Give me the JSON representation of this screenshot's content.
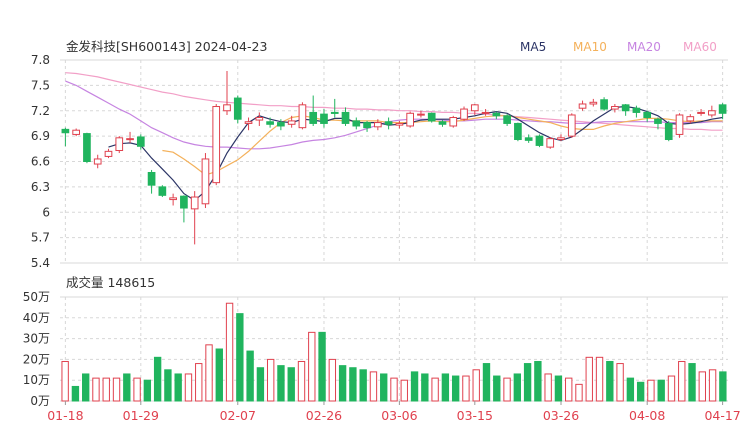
{
  "header": {
    "title": "金发科技[SH600143] 2024-04-23",
    "ma_labels": [
      {
        "label": "MA5",
        "color": "#2c3566"
      },
      {
        "label": "MA10",
        "color": "#f4b15b"
      },
      {
        "label": "MA20",
        "color": "#c684e1"
      },
      {
        "label": "MA60",
        "color": "#f29fc7"
      }
    ]
  },
  "volume_panel": {
    "label": "成交量 148615"
  },
  "colors": {
    "up": "#e0414e",
    "down": "#20b45e",
    "grid": "#d8d8d8"
  },
  "chart_data": [
    {
      "type": "candlestick",
      "title": "金发科技[SH600143] 2024-04-23",
      "ylim": [
        5.4,
        7.8
      ],
      "yticks": [
        "7.8",
        "7.5",
        "7.2",
        "6.9",
        "6.6",
        "6.3",
        "6",
        "5.7",
        "5.4"
      ],
      "ytick_values": [
        7.8,
        7.5,
        7.2,
        6.9,
        6.6,
        6.3,
        6.0,
        5.7,
        5.4
      ],
      "xtick_labels": [
        "01-18",
        "01-29",
        "02-07",
        "02-26",
        "03-06",
        "03-15",
        "03-26",
        "04-08",
        "04-17"
      ],
      "xtick_index": [
        0,
        7,
        16,
        24,
        31,
        38,
        46,
        54,
        61
      ],
      "grid": true,
      "candles": [
        [
          6.98,
          6.94,
          7.0,
          6.78
        ],
        [
          6.92,
          6.97,
          6.99,
          6.9
        ],
        [
          6.93,
          6.6,
          6.94,
          6.58
        ],
        [
          6.57,
          6.63,
          6.68,
          6.52
        ],
        [
          6.66,
          6.72,
          6.75,
          6.64
        ],
        [
          6.73,
          6.88,
          6.9,
          6.7
        ],
        [
          6.86,
          6.87,
          6.95,
          6.82
        ],
        [
          6.89,
          6.78,
          6.92,
          6.74
        ],
        [
          6.47,
          6.32,
          6.5,
          6.22
        ],
        [
          6.3,
          6.2,
          6.32,
          6.18
        ],
        [
          6.15,
          6.17,
          6.22,
          6.08
        ],
        [
          6.19,
          6.05,
          6.2,
          5.88
        ],
        [
          6.04,
          6.18,
          6.25,
          5.62
        ],
        [
          6.1,
          6.63,
          6.7,
          6.05
        ],
        [
          6.35,
          7.25,
          7.28,
          6.32
        ],
        [
          7.2,
          7.27,
          7.67,
          7.15
        ],
        [
          7.35,
          7.1,
          7.38,
          7.05
        ],
        [
          7.05,
          7.07,
          7.12,
          6.97
        ],
        [
          7.09,
          7.12,
          7.18,
          7.02
        ],
        [
          7.07,
          7.04,
          7.12,
          7.0
        ],
        [
          7.06,
          7.02,
          7.1,
          6.97
        ],
        [
          7.04,
          7.08,
          7.14,
          7.0
        ],
        [
          7.0,
          7.27,
          7.3,
          6.98
        ],
        [
          7.18,
          7.05,
          7.38,
          7.02
        ],
        [
          7.16,
          7.05,
          7.22,
          7.0
        ],
        [
          7.18,
          7.17,
          7.34,
          7.12
        ],
        [
          7.18,
          7.05,
          7.24,
          7.02
        ],
        [
          7.08,
          7.02,
          7.12,
          6.98
        ],
        [
          7.06,
          7.0,
          7.08,
          6.95
        ],
        [
          7.01,
          7.06,
          7.1,
          6.97
        ],
        [
          7.07,
          7.04,
          7.12,
          6.98
        ],
        [
          7.03,
          7.05,
          7.08,
          6.99
        ],
        [
          7.02,
          7.17,
          7.19,
          7.0
        ],
        [
          7.15,
          7.16,
          7.2,
          7.12
        ],
        [
          7.17,
          7.08,
          7.18,
          7.06
        ],
        [
          7.07,
          7.04,
          7.09,
          7.01
        ],
        [
          7.02,
          7.12,
          7.14,
          7.0
        ],
        [
          7.1,
          7.22,
          7.25,
          7.08
        ],
        [
          7.2,
          7.27,
          7.28,
          7.15
        ],
        [
          7.18,
          7.18,
          7.22,
          7.14
        ],
        [
          7.17,
          7.14,
          7.19,
          7.1
        ],
        [
          7.14,
          7.05,
          7.16,
          7.02
        ],
        [
          7.05,
          6.86,
          7.06,
          6.84
        ],
        [
          6.88,
          6.85,
          6.92,
          6.82
        ],
        [
          6.9,
          6.79,
          6.92,
          6.77
        ],
        [
          6.77,
          6.87,
          6.89,
          6.75
        ],
        [
          6.86,
          6.88,
          6.92,
          6.84
        ],
        [
          6.9,
          7.15,
          7.17,
          6.88
        ],
        [
          7.23,
          7.28,
          7.32,
          7.2
        ],
        [
          7.28,
          7.3,
          7.34,
          7.25
        ],
        [
          7.33,
          7.22,
          7.36,
          7.2
        ],
        [
          7.22,
          7.25,
          7.28,
          7.18
        ],
        [
          7.27,
          7.2,
          7.28,
          7.14
        ],
        [
          7.23,
          7.18,
          7.26,
          7.12
        ],
        [
          7.18,
          7.12,
          7.2,
          7.07
        ],
        [
          7.1,
          7.05,
          7.12,
          6.98
        ],
        [
          7.05,
          6.86,
          7.08,
          6.84
        ],
        [
          6.92,
          7.15,
          7.17,
          6.88
        ],
        [
          7.08,
          7.13,
          7.16,
          7.05
        ],
        [
          7.17,
          7.18,
          7.22,
          7.14
        ],
        [
          7.15,
          7.2,
          7.26,
          7.12
        ],
        [
          7.27,
          7.17,
          7.29,
          7.1
        ]
      ],
      "ma": {
        "MA5": [
          null,
          null,
          null,
          null,
          6.77,
          6.81,
          6.82,
          6.79,
          6.64,
          6.51,
          6.38,
          6.22,
          6.14,
          6.25,
          6.45,
          6.7,
          6.89,
          7.06,
          7.14,
          7.1,
          7.07,
          7.06,
          7.1,
          7.09,
          7.07,
          7.11,
          7.11,
          7.06,
          7.06,
          7.06,
          7.03,
          7.04,
          7.06,
          7.09,
          7.1,
          7.1,
          7.1,
          7.12,
          7.14,
          7.17,
          7.19,
          7.17,
          7.1,
          7.02,
          6.94,
          6.88,
          6.85,
          6.89,
          6.98,
          7.08,
          7.16,
          7.24,
          7.25,
          7.23,
          7.19,
          7.14,
          7.05,
          7.04,
          7.05,
          7.07,
          7.1,
          7.12
        ],
        "MA10": [
          null,
          null,
          null,
          null,
          null,
          null,
          null,
          null,
          null,
          6.73,
          6.71,
          6.63,
          6.54,
          6.44,
          6.48,
          6.55,
          6.62,
          6.72,
          6.84,
          6.96,
          7.06,
          7.12,
          7.14,
          7.12,
          7.09,
          7.09,
          7.08,
          7.08,
          7.08,
          7.08,
          7.06,
          7.06,
          7.06,
          7.07,
          7.08,
          7.07,
          7.07,
          7.09,
          7.11,
          7.13,
          7.14,
          7.14,
          7.12,
          7.1,
          7.08,
          7.06,
          7.02,
          6.99,
          6.98,
          6.98,
          7.02,
          7.05,
          7.07,
          7.09,
          7.11,
          7.11,
          7.1,
          7.08,
          7.07,
          7.08,
          7.08,
          7.08
        ],
        "MA20": [
          7.55,
          7.5,
          7.43,
          7.36,
          7.29,
          7.22,
          7.16,
          7.08,
          7.0,
          6.94,
          6.88,
          6.83,
          6.8,
          6.78,
          6.77,
          6.77,
          6.76,
          6.75,
          6.75,
          6.76,
          6.78,
          6.8,
          6.83,
          6.85,
          6.86,
          6.88,
          6.91,
          6.95,
          6.99,
          7.03,
          7.07,
          7.09,
          7.1,
          7.1,
          7.1,
          7.09,
          7.08,
          7.08,
          7.09,
          7.1,
          7.1,
          7.1,
          7.09,
          7.08,
          7.07,
          7.07,
          7.06,
          7.05,
          7.05,
          7.06,
          7.07,
          7.07,
          7.07,
          7.07,
          7.07,
          7.07,
          7.06,
          7.06,
          7.06,
          7.06,
          7.07,
          7.07
        ],
        "MA60": [
          7.65,
          7.64,
          7.62,
          7.6,
          7.57,
          7.54,
          7.51,
          7.48,
          7.45,
          7.42,
          7.4,
          7.37,
          7.35,
          7.33,
          7.31,
          7.3,
          7.29,
          7.28,
          7.27,
          7.26,
          7.26,
          7.25,
          7.25,
          7.24,
          7.24,
          7.23,
          7.23,
          7.22,
          7.22,
          7.21,
          7.21,
          7.2,
          7.2,
          7.19,
          7.19,
          7.18,
          7.18,
          7.17,
          7.17,
          7.16,
          7.15,
          7.14,
          7.13,
          7.12,
          7.11,
          7.1,
          7.09,
          7.08,
          7.07,
          7.06,
          7.05,
          7.04,
          7.03,
          7.02,
          7.01,
          7.0,
          6.99,
          6.99,
          6.98,
          6.98,
          6.97,
          6.97
        ]
      }
    },
    {
      "type": "bar",
      "title": "成交量 148615",
      "unit": "万",
      "ylim": [
        0,
        50
      ],
      "yticks": [
        "50万",
        "40万",
        "30万",
        "20万",
        "10万",
        "0万"
      ],
      "ytick_values": [
        50,
        40,
        30,
        20,
        10,
        0
      ],
      "values": [
        19,
        7,
        13,
        11,
        11,
        11,
        13,
        11,
        10,
        21,
        15,
        13,
        13,
        18,
        27,
        25,
        47,
        42,
        24,
        16,
        20,
        17,
        16,
        19,
        33,
        33,
        20,
        17,
        16,
        15,
        14,
        13,
        11,
        10,
        14,
        13,
        11,
        13,
        12,
        12,
        15,
        18,
        12,
        11,
        13,
        18,
        19,
        13,
        12,
        11,
        8,
        21,
        21,
        19,
        18,
        11,
        9,
        10,
        10,
        12,
        19,
        18,
        14,
        15,
        14
      ],
      "directions": [
        "up",
        "down",
        "down",
        "up",
        "up",
        "up",
        "down",
        "up",
        "down",
        "down",
        "down",
        "down",
        "up",
        "up",
        "up",
        "down",
        "up",
        "down",
        "down",
        "down",
        "up",
        "down",
        "down",
        "up",
        "up",
        "down",
        "up",
        "down",
        "down",
        "down",
        "up",
        "down",
        "up",
        "up",
        "down",
        "down",
        "up",
        "down",
        "down",
        "up",
        "up",
        "down",
        "down",
        "up",
        "down",
        "down",
        "down",
        "up",
        "down",
        "up",
        "up",
        "up",
        "up",
        "down",
        "up",
        "down",
        "down",
        "up",
        "down",
        "up",
        "up",
        "down",
        "up",
        "up",
        "down"
      ]
    }
  ]
}
